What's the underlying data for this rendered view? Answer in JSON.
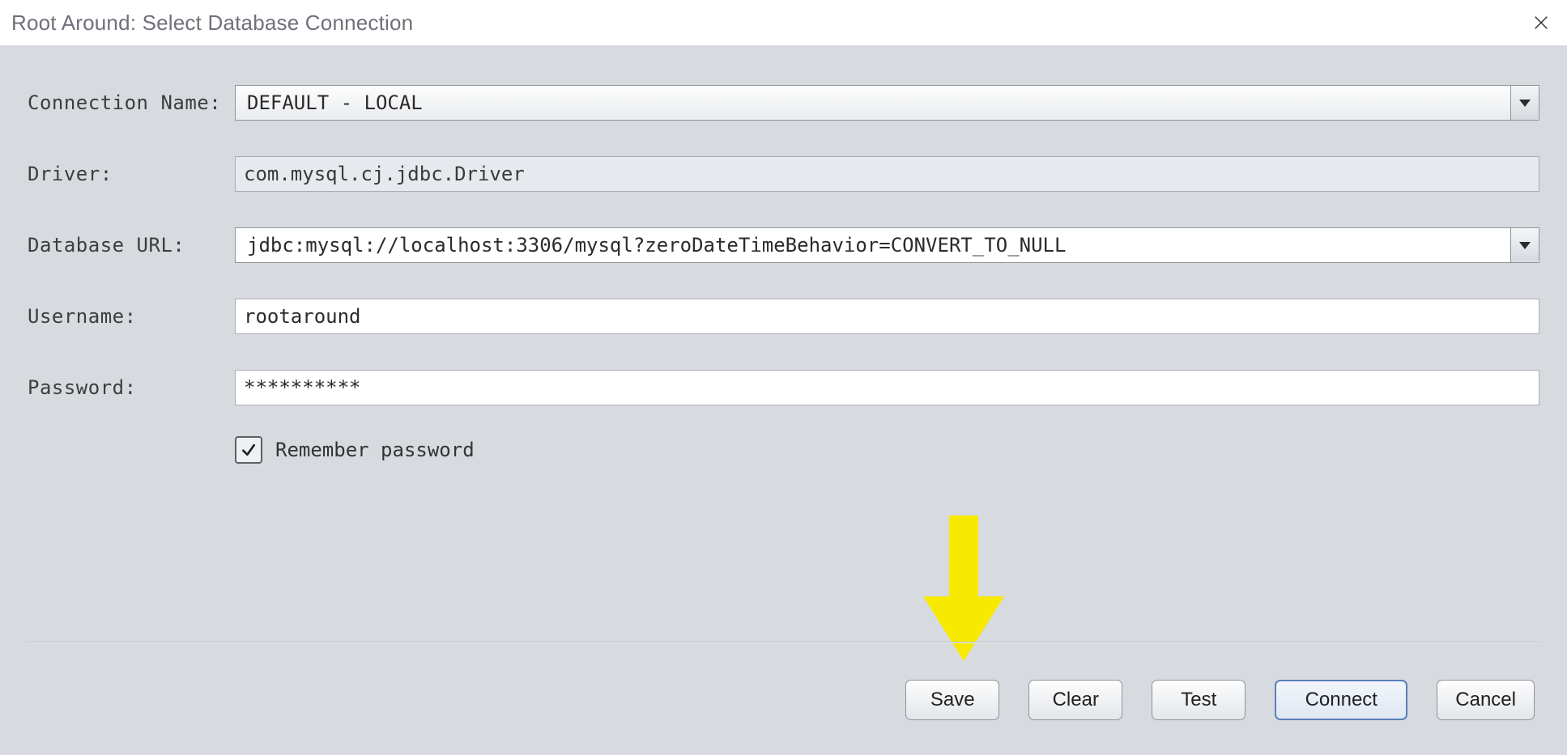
{
  "titlebar": {
    "title": "Root Around: Select Database Connection"
  },
  "form": {
    "connection_name_label": "Connection Name:",
    "connection_name_value": "DEFAULT - LOCAL",
    "driver_label": "Driver:",
    "driver_value": "com.mysql.cj.jdbc.Driver",
    "database_url_label": "Database URL:",
    "database_url_value": "jdbc:mysql://localhost:3306/mysql?zeroDateTimeBehavior=CONVERT_TO_NULL",
    "username_label": "Username:",
    "username_value": "rootaround",
    "password_label": "Password:",
    "password_value": "**********",
    "remember_password_label": "Remember password",
    "remember_password_checked": true
  },
  "buttons": {
    "save": "Save",
    "clear": "Clear",
    "test": "Test",
    "connect": "Connect",
    "cancel": "Cancel"
  },
  "annotation": {
    "arrow_color": "#f7ea00",
    "arrow_target": "save-button"
  }
}
